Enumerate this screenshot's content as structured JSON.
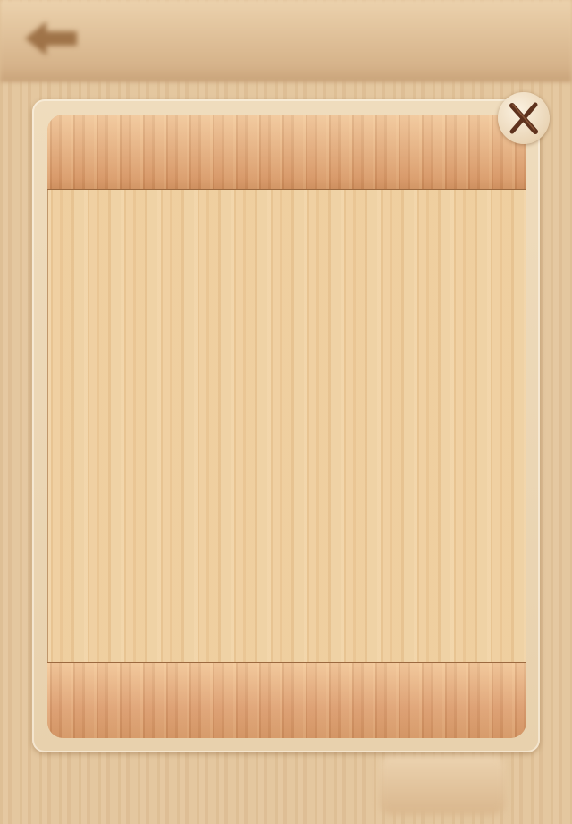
{
  "background": {
    "header_title": "",
    "action_button_label": "",
    "icons": {
      "back": "back-arrow-icon"
    }
  },
  "dialog": {
    "icons": {
      "close": "close-icon"
    },
    "colors": {
      "frame": "#efdcbd",
      "wood_light": "#eccb9b",
      "wood_dark": "#d69a6b",
      "close_glyph": "#6b3a22"
    }
  }
}
